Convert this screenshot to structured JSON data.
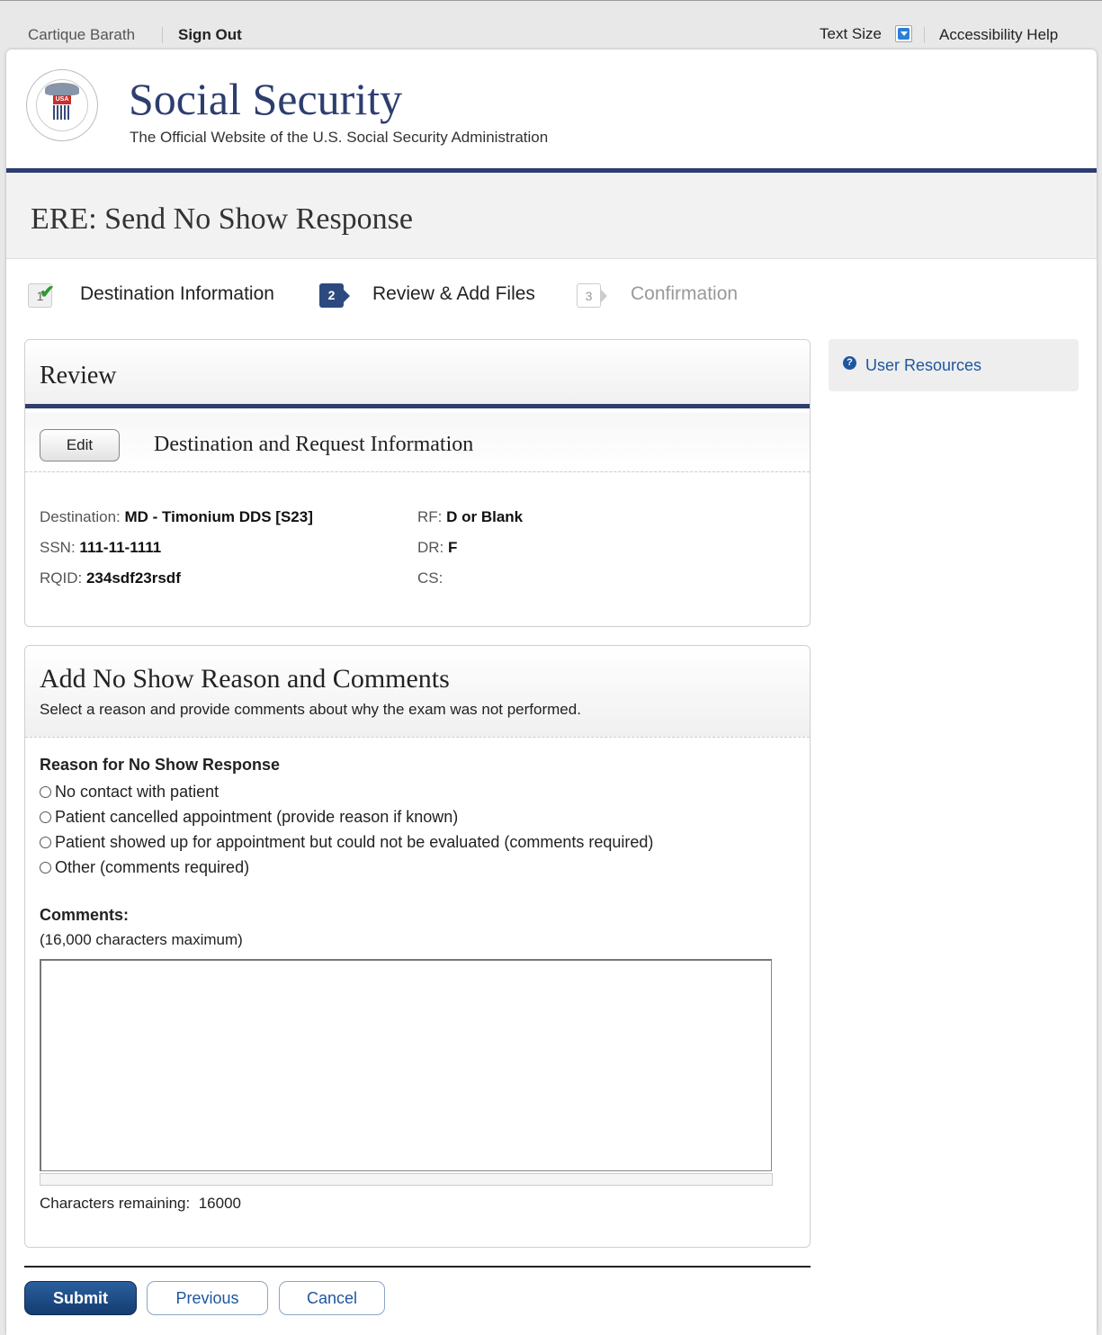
{
  "topbar": {
    "user_name": "Cartique Barath",
    "sign_out": "Sign Out",
    "text_size": "Text Size",
    "accessibility_help": "Accessibility Help"
  },
  "header": {
    "brand": "Social Security",
    "tagline": "The Official Website of the U.S. Social Security Administration",
    "seal_text": "USA",
    "accent_color": "#2d3e6e"
  },
  "page_title": "ERE: Send No Show Response",
  "steps": [
    {
      "number": "1",
      "label": "Destination Information",
      "state": "done"
    },
    {
      "number": "2",
      "label": "Review & Add Files",
      "state": "active"
    },
    {
      "number": "3",
      "label": "Confirmation",
      "state": "future"
    }
  ],
  "review": {
    "title": "Review",
    "edit_label": "Edit",
    "section_title": "Destination and Request Information",
    "fields": {
      "destination_label": "Destination:",
      "destination_value": "MD - Timonium DDS [S23]",
      "ssn_label": "SSN:",
      "ssn_value": "111-11-1111",
      "rqid_label": "RQID:",
      "rqid_value": "234sdf23rsdf",
      "rf_label": "RF:",
      "rf_value": "D or Blank",
      "dr_label": "DR:",
      "dr_value": "F",
      "cs_label": "CS:",
      "cs_value": ""
    }
  },
  "no_show": {
    "title": "Add No Show Reason and Comments",
    "description": "Select a reason and provide comments about why the exam was not performed.",
    "reason_label": "Reason for No Show Response",
    "options": [
      "No contact with patient",
      "Patient cancelled appointment (provide reason if known)",
      "Patient showed up for appointment but could not be evaluated (comments required)",
      "Other (comments required)"
    ],
    "comments_label": "Comments:",
    "comments_max": "(16,000 characters maximum)",
    "comments_value": "",
    "remaining_label": "Characters remaining:",
    "remaining_value": "16000"
  },
  "actions": {
    "submit": "Submit",
    "previous": "Previous",
    "cancel": "Cancel"
  },
  "sidebar": {
    "user_resources": "User Resources",
    "help_icon": "question-circle-icon"
  }
}
